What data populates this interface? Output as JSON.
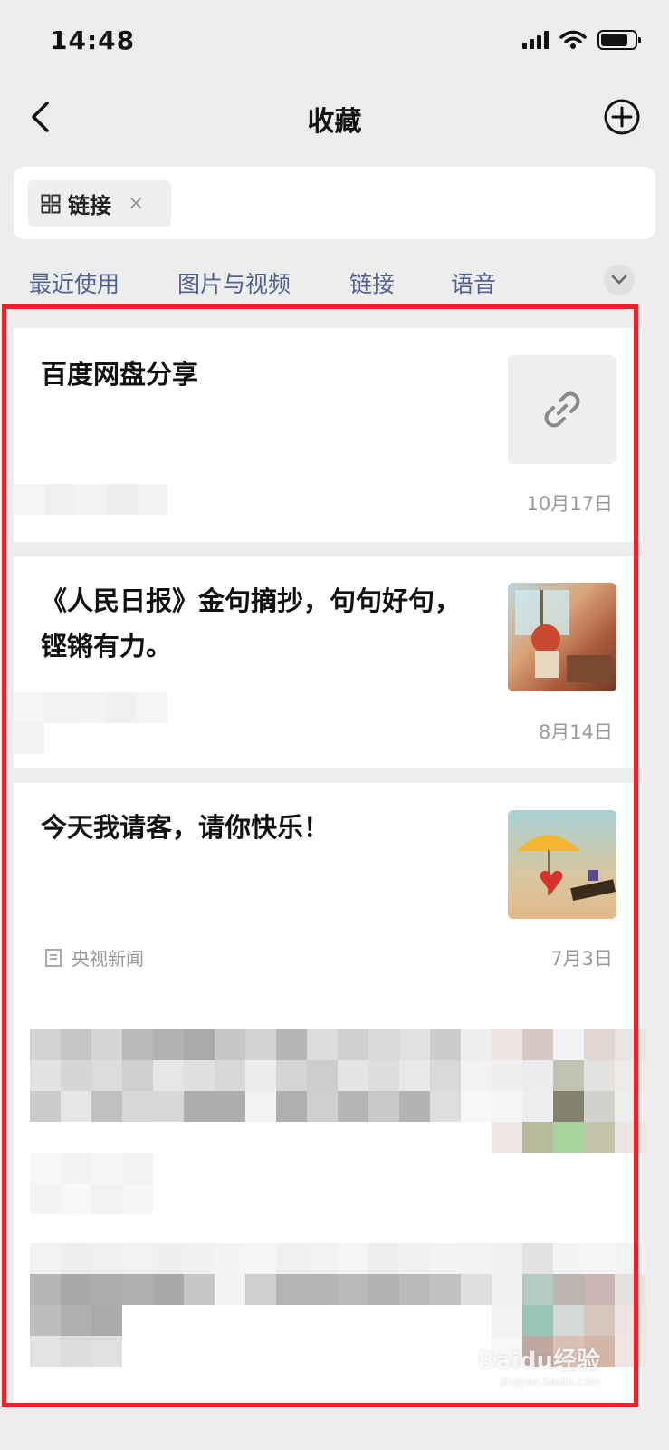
{
  "status_bar": {
    "time": "14:48"
  },
  "nav": {
    "title": "收藏"
  },
  "filter": {
    "chip_label": "链接",
    "chip_close": "×"
  },
  "tabs": [
    "最近使用",
    "图片与视频",
    "链接",
    "语音"
  ],
  "items": [
    {
      "title": "百度网盘分享",
      "date": "10月17日",
      "thumb": "link-icon"
    },
    {
      "title": "《人民日报》金句摘抄，句句好句，铿锵有力。",
      "date": "8月14日",
      "thumb": "anime-girl-image"
    },
    {
      "title": "今天我请客，请你快乐！",
      "date": "7月3日",
      "source": "央视新闻",
      "thumb": "umbrella-heart-image"
    }
  ],
  "watermark": {
    "text": "Baidu经验",
    "sub": "jingyan.baidu.com"
  },
  "colors": {
    "tab": "#51628f",
    "frame": "#e8242a",
    "background": "#ededed"
  }
}
